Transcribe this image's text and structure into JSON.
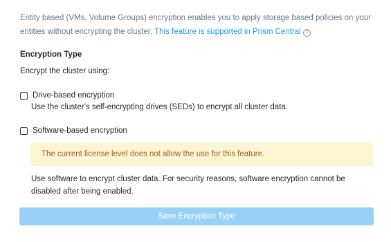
{
  "intro": {
    "text": "Entity based (VMs, Volume Groups) encryption enables you to apply storage based policies on your entities without encrypting the cluster. ",
    "link_text": "This feature is supported in Prism Central",
    "help_icon": "?"
  },
  "encryption_type": {
    "title": "Encryption Type",
    "subtitle": "Encrypt the cluster using:"
  },
  "options": {
    "drive": {
      "label": "Drive-based encryption",
      "description": "Use the cluster's self-encrypting drives (SEDs) to encrypt all cluster data.",
      "checked": false
    },
    "software": {
      "label": "Software-based encryption",
      "warning": "The current license level does not allow the use for this feature.",
      "description": "Use software to encrypt cluster data. For security reasons, software encryption cannot be disabled after being enabled.",
      "checked": false
    }
  },
  "save_button": {
    "label": "Save Encryption Type",
    "disabled": true
  },
  "colors": {
    "link": "#1b9ee0",
    "warning_bg": "#fdf4d4",
    "warning_text": "#a0631a",
    "button_disabled_bg": "#99d0f7"
  }
}
